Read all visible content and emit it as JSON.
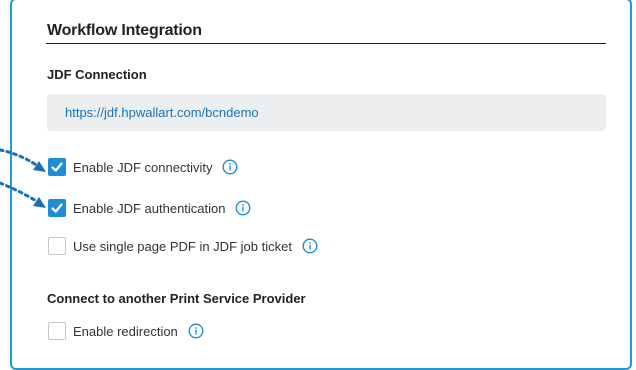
{
  "panel": {
    "title": "Workflow Integration",
    "accent_color": "#1e9ad6"
  },
  "jdf": {
    "section_label": "JDF Connection",
    "url_value": "https://jdf.hpwallart.com/bcndemo"
  },
  "options": [
    {
      "label": "Enable JDF connectivity",
      "checked": true,
      "info_icon": "info-icon"
    },
    {
      "label": "Enable JDF authentication",
      "checked": true,
      "info_icon": "info-icon"
    },
    {
      "label": "Use single page PDF in JDF job ticket",
      "checked": false,
      "info_icon": "info-icon"
    }
  ],
  "provider": {
    "section_label": "Connect to another Print Service Provider",
    "redirection_label": "Enable redirection",
    "redirection_checked": false
  },
  "annotations": {
    "arrow_color": "#1a6fb5"
  }
}
